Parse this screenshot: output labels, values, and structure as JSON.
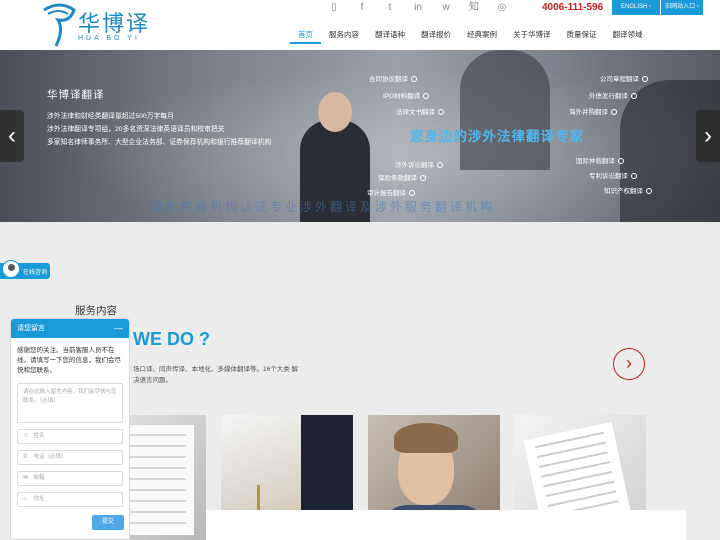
{
  "header": {
    "logo_cn": "华博译",
    "logo_en": "HUA BO YI",
    "social_icons": [
      "mobile-icon",
      "facebook-icon",
      "twitter-icon",
      "linkedin-icon",
      "weibo-icon",
      "zhihu-icon",
      "wechat-icon"
    ],
    "social_glyphs": [
      "▯",
      "f",
      "t",
      "in",
      "w",
      "知",
      "◎"
    ],
    "phone": "4006-111-596",
    "btn_english": "ENGLISH ›",
    "btn_old_site": "旧网站入口 ›"
  },
  "nav": {
    "items": [
      "首页",
      "服务内容",
      "翻译语种",
      "翻译报价",
      "经典案例",
      "关于华博译",
      "质量保证",
      "翻译领域"
    ],
    "active_index": 0
  },
  "banner": {
    "title": "华博译翻译",
    "lines": [
      "涉外法律和财经类翻译量超过500万字每月",
      "涉外法律翻译专项组，20多名资深法律英语译员和校审把关",
      "多家知名律师事务所、大型企业法务部、证券保荐机构和银行推荐翻译机构"
    ],
    "slogan": "您身边的涉外法律翻译专家",
    "bottom_text": "国家权威机构认证专业涉外翻译及涉外服务翻译机构",
    "tags_left": [
      "合同协议翻译",
      "IPO材料翻译",
      "法律文书翻译",
      "涉外诉讼翻译",
      "保险条款翻译",
      "审计报告翻译"
    ],
    "tags_right": [
      "公司章程翻译",
      "外债发行翻译",
      "海外并购翻译",
      "国际仲裁翻译",
      "专利诉讼翻译",
      "知识产权翻译"
    ],
    "prev": "‹",
    "next": "›"
  },
  "services": {
    "title": "服务内容",
    "heading": "WE DO ?",
    "description": "场口译、同声传译、本地化、多媒体翻译等。16个大类 解决语言问题。",
    "next_arrow": "›"
  },
  "consult": {
    "label": "在线咨询"
  },
  "chat": {
    "title": "请您留言",
    "minimize": "—",
    "message": "感谢您的关注。当前客服人员不在线，请填写一下您的信息，我们会尽快和您联系。",
    "textarea_placeholder": "请在此输入留言内容，我们会尽快与您联系。（必填）",
    "fields": [
      {
        "icon": "user-icon",
        "glyph": "☺",
        "placeholder": "姓名"
      },
      {
        "icon": "phone-icon",
        "glyph": "✆",
        "placeholder": "电话（必填）"
      },
      {
        "icon": "email-icon",
        "glyph": "✉",
        "placeholder": "邮箱"
      },
      {
        "icon": "location-icon",
        "glyph": "⌂",
        "placeholder": "地址"
      }
    ],
    "submit": "提交"
  }
}
